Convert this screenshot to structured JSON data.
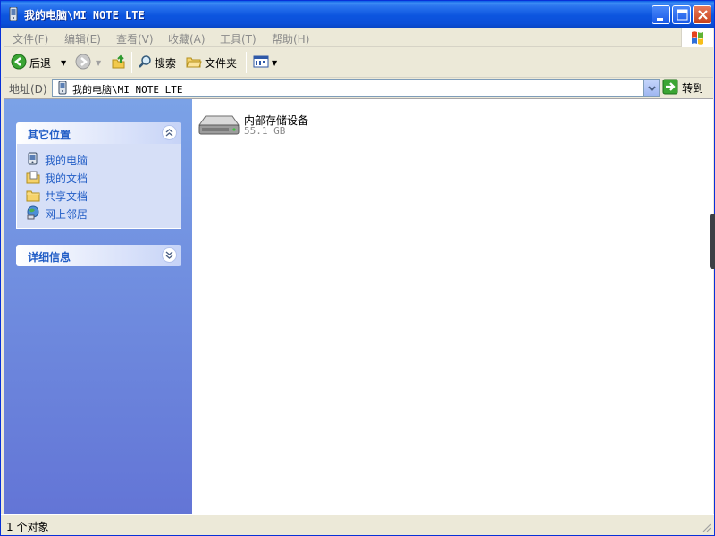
{
  "window": {
    "title": "我的电脑\\MI NOTE LTE"
  },
  "menu": {
    "items": [
      "文件(F)",
      "编辑(E)",
      "查看(V)",
      "收藏(A)",
      "工具(T)",
      "帮助(H)"
    ]
  },
  "toolbar": {
    "back_label": "后退",
    "search_label": "搜索",
    "folders_label": "文件夹"
  },
  "address": {
    "label": "地址(D)",
    "value": "我的电脑\\MI NOTE LTE",
    "go_label": "转到"
  },
  "taskpane": {
    "other_places_title": "其它位置",
    "places": [
      {
        "label": "我的电脑",
        "icon": "computer-icon"
      },
      {
        "label": "我的文档",
        "icon": "documents-icon"
      },
      {
        "label": "共享文档",
        "icon": "folder-icon"
      },
      {
        "label": "网上邻居",
        "icon": "network-icon"
      }
    ],
    "details_title": "详细信息"
  },
  "main": {
    "items": [
      {
        "name": "内部存储设备",
        "size": "55.1 GB",
        "icon": "storage-drive-icon"
      }
    ]
  },
  "status": {
    "text": "1 个对象"
  },
  "colors": {
    "titlebar": "#0B4FD9",
    "taskpane_top": "#7BA2E7",
    "taskpane_bottom": "#6375D6",
    "link": "#215DC6"
  }
}
